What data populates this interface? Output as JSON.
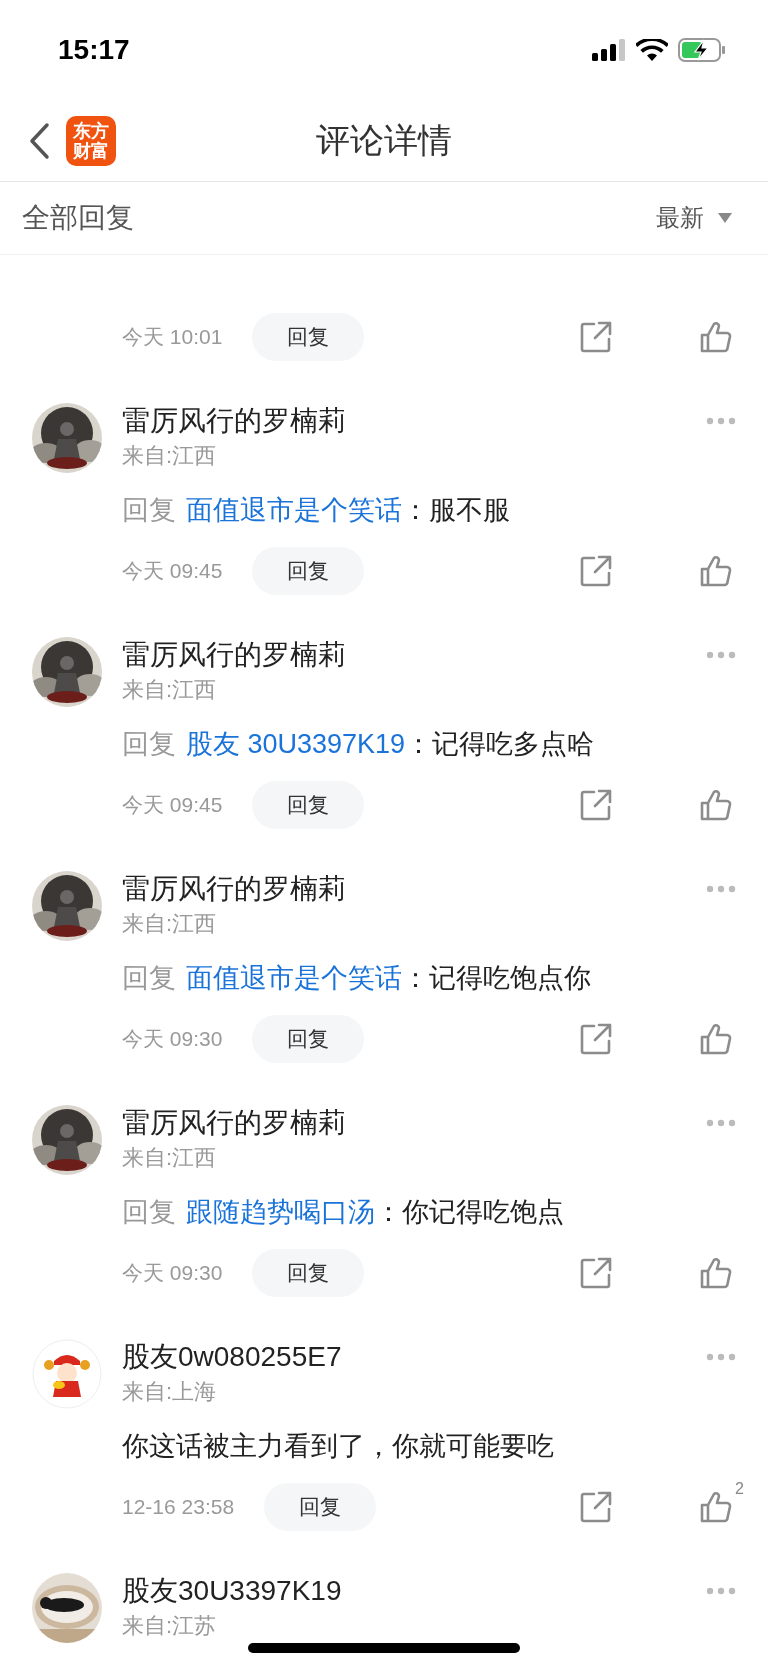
{
  "status_bar": {
    "time": "15:17"
  },
  "nav_bar": {
    "logo": [
      "东方",
      "财富"
    ],
    "title": "评论详情"
  },
  "sub_header": {
    "label": "全部回复",
    "sort": "最新"
  },
  "comments": [
    {
      "kind": "partial",
      "time": "今天 10:01",
      "reply_button": "回复"
    },
    {
      "kind": "reply",
      "name": "雷厉风行的罗楠莉",
      "location": "来自:江西",
      "reply_label": "回复",
      "reply_to": "面值退市是个笑话",
      "text": "：服不服",
      "time": "今天 09:45",
      "reply_button": "回复"
    },
    {
      "kind": "reply",
      "name": "雷厉风行的罗楠莉",
      "location": "来自:江西",
      "reply_label": "回复",
      "reply_to": "股友 30U3397K19",
      "text": "：记得吃多点哈",
      "time": "今天 09:45",
      "reply_button": "回复"
    },
    {
      "kind": "reply",
      "name": "雷厉风行的罗楠莉",
      "location": "来自:江西",
      "reply_label": "回复",
      "reply_to": "面值退市是个笑话",
      "text": "：记得吃饱点你",
      "time": "今天 09:30",
      "reply_button": "回复"
    },
    {
      "kind": "reply",
      "name": "雷厉风行的罗楠莉",
      "location": "来自:江西",
      "reply_label": "回复",
      "reply_to": "跟随趋势喝口汤",
      "text": "：你记得吃饱点",
      "time": "今天 09:30",
      "reply_button": "回复"
    },
    {
      "kind": "plain",
      "name": "股友0w080255E7",
      "location": "来自:上海",
      "text": "你这话被主力看到了，你就可能要吃",
      "time": "12-16 23:58",
      "reply_button": "回复",
      "likes": "2"
    },
    {
      "kind": "header_only",
      "name": "股友30U3397K19",
      "location": "来自:江苏"
    }
  ]
}
